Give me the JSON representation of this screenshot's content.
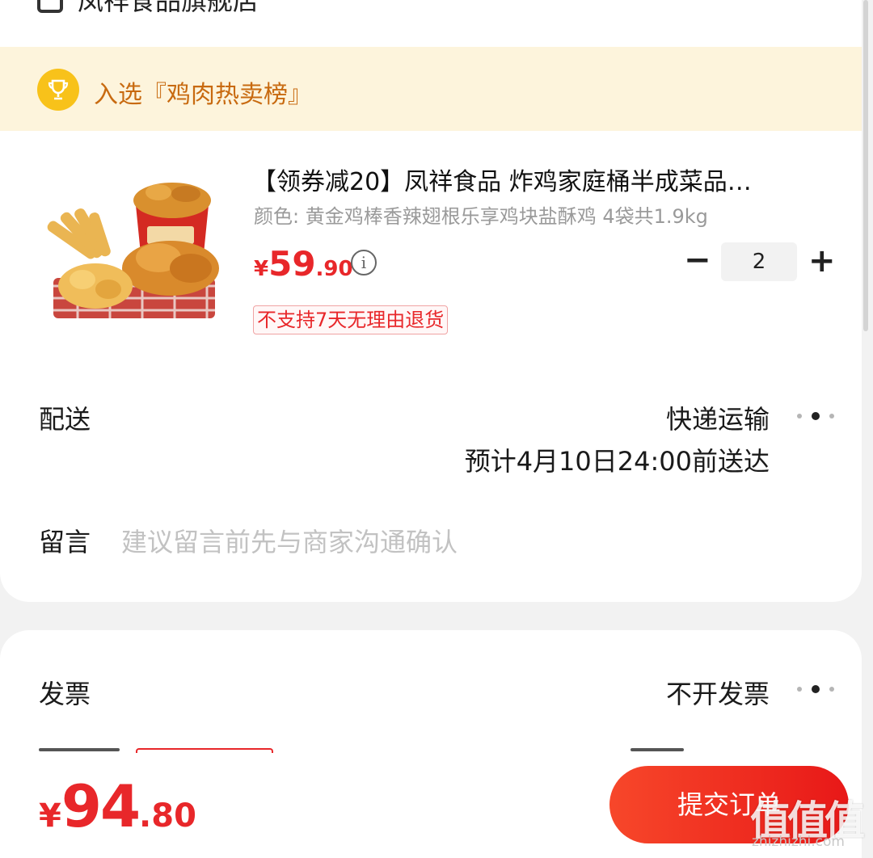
{
  "store": {
    "name": "凤祥食品旗舰店",
    "icon": "store-icon"
  },
  "banner": {
    "text": "入选『鸡肉热卖榜』",
    "icon": "trophy-icon"
  },
  "product": {
    "title": "【领券减20】凤祥食品 炸鸡家庭桶半成菜品…",
    "spec": "颜色: 黄金鸡棒香辣翅根乐享鸡块盐酥鸡 4袋共1.9kg",
    "price_currency": "¥",
    "price_int": "59",
    "price_dec": ".90",
    "quantity": "2",
    "return_tag": "不支持7天无理由退货",
    "image_icon": "fried-chicken-bucket-image"
  },
  "delivery": {
    "label": "配送",
    "method": "快递运输",
    "eta": "预计4月10日24:00前送达"
  },
  "remark": {
    "label": "留言",
    "placeholder": "建议留言前先与商家沟通确认"
  },
  "invoice": {
    "label": "发票",
    "value": "不开发票"
  },
  "footer": {
    "total_currency": "¥",
    "total_int": "94",
    "total_dec": ".80",
    "submit_label": "提交订单"
  },
  "watermark": {
    "logo": "值值值",
    "url": "zhizhizhi.com"
  },
  "colors": {
    "accent_red": "#e8272a",
    "banner_bg": "#fdf4dc",
    "banner_text": "#c86a10",
    "trophy": "#f8c21a"
  }
}
